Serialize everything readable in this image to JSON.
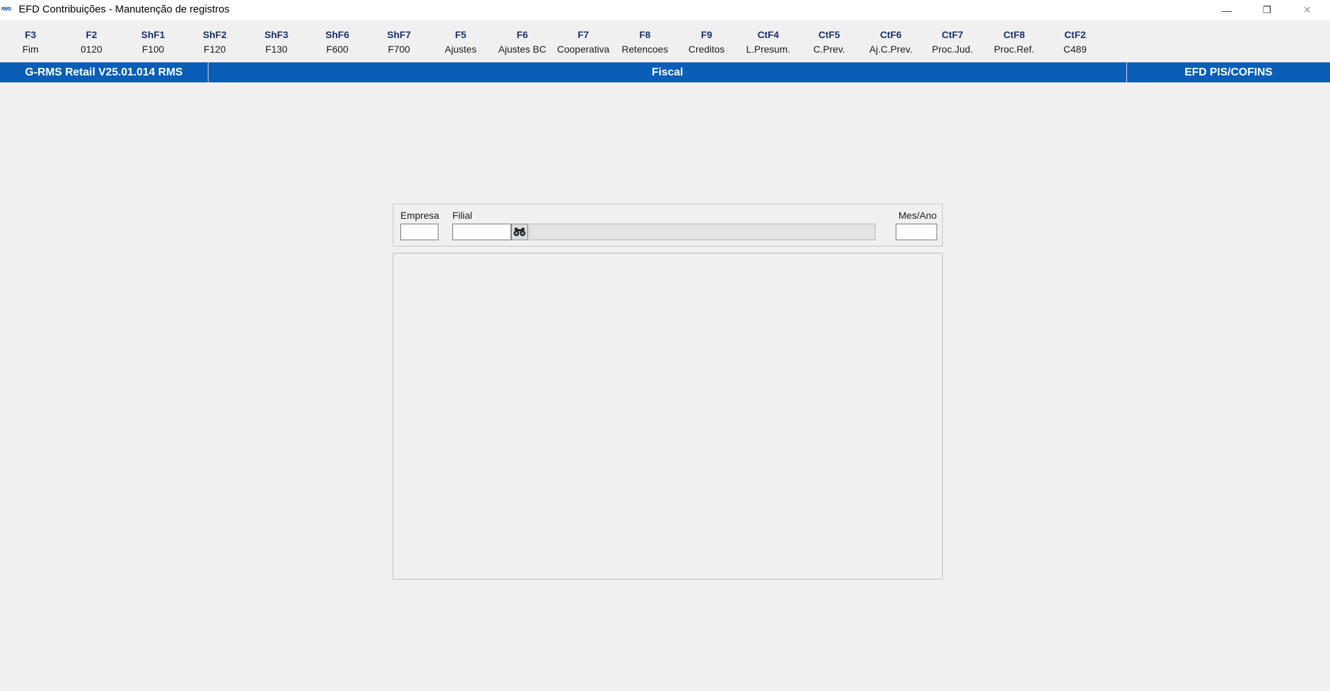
{
  "window": {
    "app_icon_text": "RMS",
    "title": "EFD Contribuições - Manutenção de registros",
    "minimize_symbol": "—",
    "restore_symbol": "❐",
    "close_symbol": "✕"
  },
  "toolbar": {
    "items": [
      {
        "key": "F3",
        "label": "Fim"
      },
      {
        "key": "F2",
        "label": "0120"
      },
      {
        "key": "ShF1",
        "label": "F100"
      },
      {
        "key": "ShF2",
        "label": "F120"
      },
      {
        "key": "ShF3",
        "label": "F130"
      },
      {
        "key": "ShF6",
        "label": "F600"
      },
      {
        "key": "ShF7",
        "label": "F700"
      },
      {
        "key": "F5",
        "label": "Ajustes"
      },
      {
        "key": "F6",
        "label": "Ajustes BC"
      },
      {
        "key": "F7",
        "label": "Cooperativa"
      },
      {
        "key": "F8",
        "label": "Retencoes"
      },
      {
        "key": "F9",
        "label": "Creditos"
      },
      {
        "key": "CtF4",
        "label": "L.Presum."
      },
      {
        "key": "CtF5",
        "label": "C.Prev."
      },
      {
        "key": "CtF6",
        "label": "Aj.C.Prev."
      },
      {
        "key": "CtF7",
        "label": "Proc.Jud."
      },
      {
        "key": "CtF8",
        "label": "Proc.Ref."
      },
      {
        "key": "CtF2",
        "label": "C489"
      }
    ]
  },
  "statusbar": {
    "version": "G-RMS Retail V25.01.014 RMS",
    "module": "Fiscal",
    "routine": "EFD PIS/COFINS"
  },
  "filter": {
    "empresa_label": "Empresa",
    "empresa_value": "",
    "filial_label": "Filial",
    "filial_value": "",
    "filial_description": "",
    "mes_ano_label": "Mes/Ano",
    "mes_ano_value": ""
  },
  "colors": {
    "statusbar_bg": "#0a5eb7",
    "toolbar_key": "#1b2f6b",
    "background": "#f0f0f0"
  }
}
